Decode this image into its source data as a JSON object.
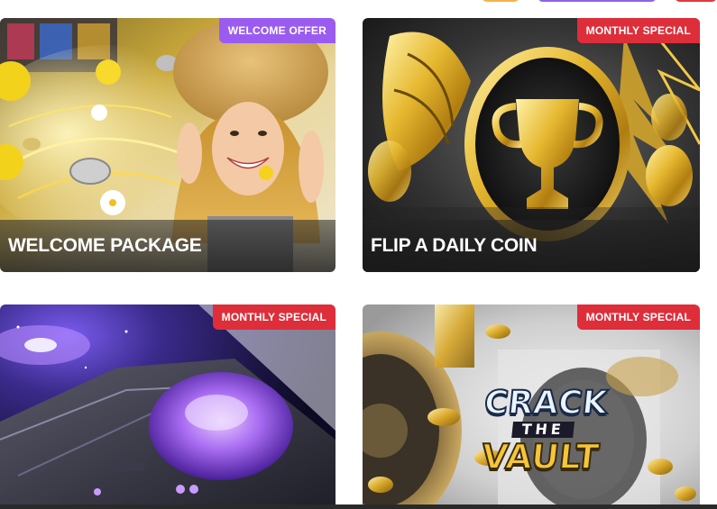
{
  "colors": {
    "offer_purple": "#9a5cf0",
    "special_red": "#de2e3a"
  },
  "promotions": [
    {
      "title": "WELCOME PACKAGE",
      "badge": "WELCOME OFFER",
      "badge_color": "#9a5cf0",
      "image": "woman-in-straw-hat-with-gold-coins-illustration"
    },
    {
      "title": "FLIP A DAILY COIN",
      "badge": "MONTHLY SPECIAL",
      "badge_color": "#de2e3a",
      "image": "gold-trophy-coin-illustration"
    },
    {
      "title": "",
      "badge": "MONTHLY SPECIAL",
      "badge_color": "#de2e3a",
      "image": "purple-spaceship-galaxy-illustration"
    },
    {
      "title": "",
      "badge": "MONTHLY SPECIAL",
      "badge_color": "#de2e3a",
      "image": "vault-door-with-gold-coins-illustration",
      "logo_text": [
        "CRACK",
        "THE",
        "VAULT"
      ]
    }
  ]
}
